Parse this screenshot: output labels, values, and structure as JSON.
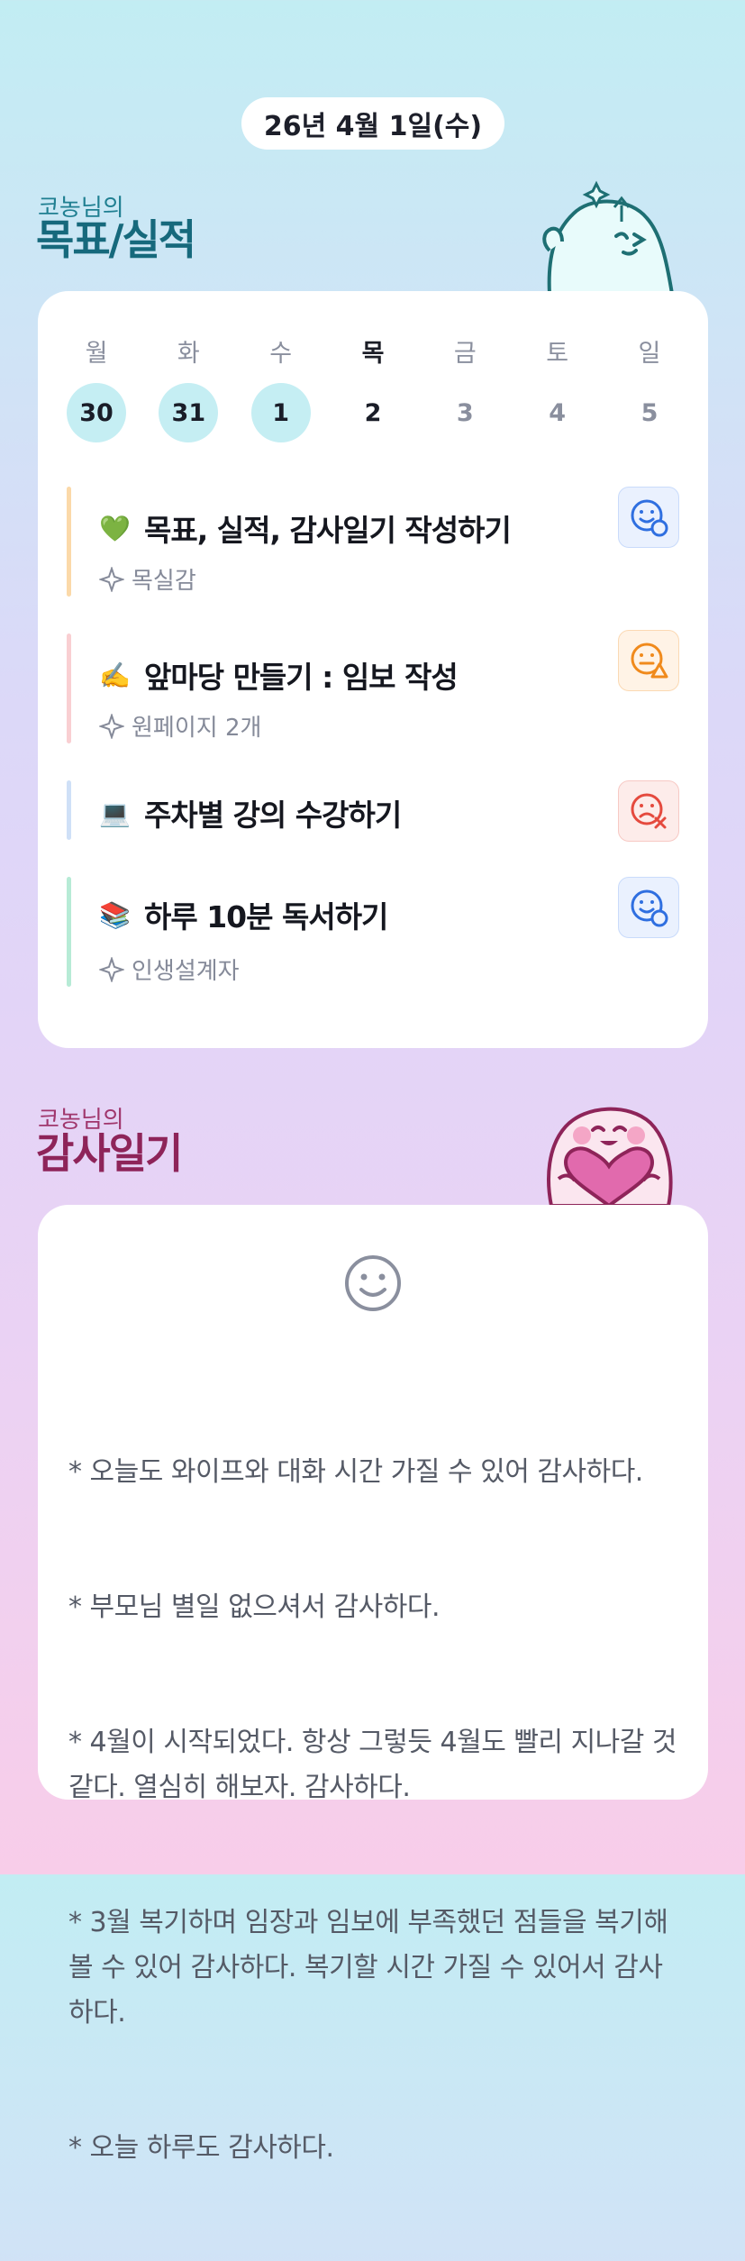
{
  "date": "26년 4월 1일(수)",
  "goals_section": {
    "subtitle": "코농님의",
    "title": "목표/실적"
  },
  "week": {
    "days": [
      {
        "name": "월",
        "num": "30"
      },
      {
        "name": "화",
        "num": "31"
      },
      {
        "name": "수",
        "num": "1"
      },
      {
        "name": "목",
        "num": "2"
      },
      {
        "name": "금",
        "num": "3"
      },
      {
        "name": "토",
        "num": "4"
      },
      {
        "name": "일",
        "num": "5"
      }
    ]
  },
  "goals": [
    {
      "emoji": "💚",
      "title": "목표, 실적, 감사일기 작성하기",
      "sub": "목실감",
      "bar_color": "#fbd9a9",
      "status": "good"
    },
    {
      "emoji": "✍️",
      "title": "앞마당 만들기 : 임보 작성",
      "sub": "원페이지 2개",
      "bar_color": "#f9cfd2",
      "status": "warning"
    },
    {
      "emoji": "💻",
      "title": "주차별 강의 수강하기",
      "sub": "",
      "bar_color": "#cfe0f7",
      "status": "fail"
    },
    {
      "emoji": "📚",
      "title": "하루 10분 독서하기",
      "sub": "인생설계자",
      "bar_color": "#b7ebd6",
      "status": "good"
    }
  ],
  "status_icons": {
    "good": "smile-check-icon",
    "warning": "neutral-warning-icon",
    "fail": "sad-x-icon"
  },
  "colors": {
    "good": "#2f6fe0",
    "warning": "#f08a1c",
    "fail": "#e54a3e"
  },
  "gratitude_section": {
    "subtitle": "코농님의",
    "title": "감사일기",
    "mood_icon": "smile-icon",
    "lines": [
      "* 오늘도 와이프와 대화 시간 가질 수 있어 감사하다.",
      "* 부모님 별일 없으셔서 감사하다.",
      "* 4월이 시작되었다. 항상 그렇듯 4월도 빨리 지나갈 것 같다. 열심히 해보자. 감사하다.",
      "* 3월 복기하며 임장과 임보에 부족했던 점들을 복기해 볼 수 있어 감사하다. 복기할 시간 가질 수 있어서 감사하다.",
      "* 오늘 하루도 감사하다."
    ]
  }
}
